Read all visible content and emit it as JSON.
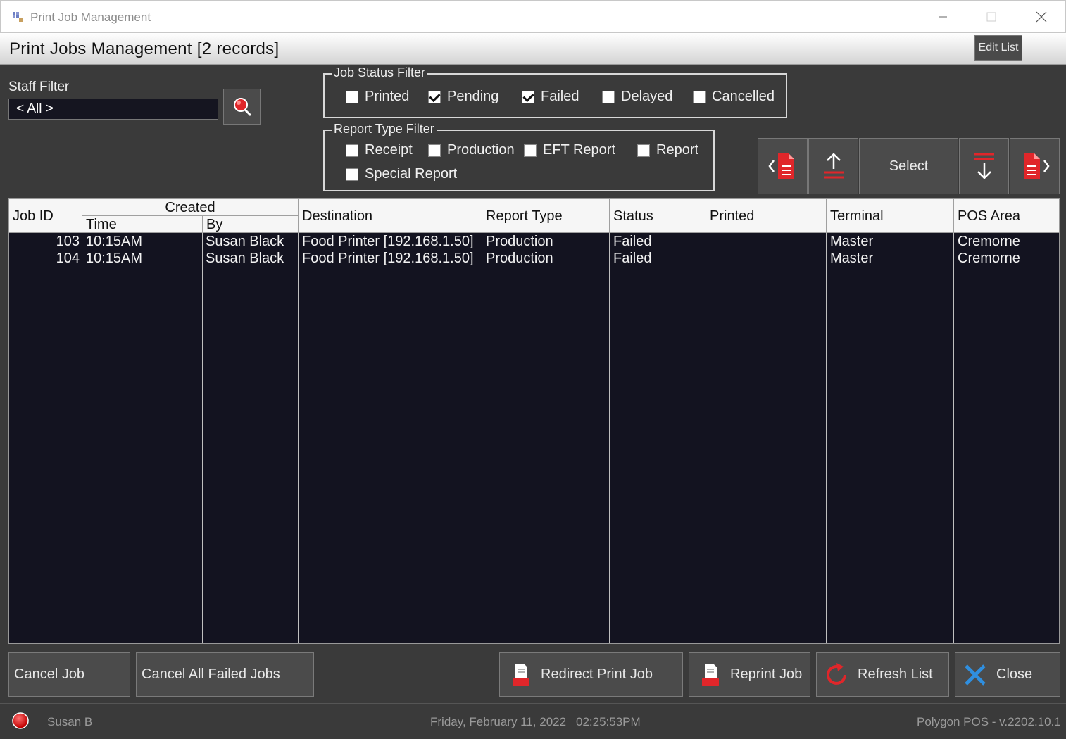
{
  "window": {
    "title": "Print Job Management"
  },
  "header": {
    "title": "Print Jobs Management [2 records]",
    "edit_list_label": "Edit List"
  },
  "staff_filter": {
    "label": "Staff Filter",
    "value": "< All >"
  },
  "job_status_filter": {
    "title": "Job Status Filter",
    "options": [
      {
        "label": "Printed",
        "checked": false
      },
      {
        "label": "Pending",
        "checked": true
      },
      {
        "label": "Failed",
        "checked": true
      },
      {
        "label": "Delayed",
        "checked": false
      },
      {
        "label": "Cancelled",
        "checked": false
      }
    ]
  },
  "report_type_filter": {
    "title": "Report Type Filter",
    "options": [
      {
        "label": "Receipt",
        "checked": false
      },
      {
        "label": "Production",
        "checked": false
      },
      {
        "label": "EFT Report",
        "checked": false
      },
      {
        "label": "Report",
        "checked": false
      },
      {
        "label": "Special Report",
        "checked": false
      }
    ]
  },
  "nav": {
    "select_label": "Select"
  },
  "grid": {
    "columns": {
      "job_id": "Job ID",
      "created": "Created",
      "time": "Time",
      "by": "By",
      "destination": "Destination",
      "report_type": "Report Type",
      "status": "Status",
      "printed": "Printed",
      "terminal": "Terminal",
      "pos_area": "POS Area"
    },
    "rows": [
      {
        "job_id": "103",
        "time": "10:15AM",
        "by": "Susan Black",
        "destination": "Food Printer [192.168.1.50]",
        "report_type": "Production",
        "status": "Failed",
        "printed": "",
        "terminal": "Master",
        "pos_area": "Cremorne"
      },
      {
        "job_id": "104",
        "time": "10:15AM",
        "by": "Susan Black",
        "destination": "Food Printer [192.168.1.50]",
        "report_type": "Production",
        "status": "Failed",
        "printed": "",
        "terminal": "Master",
        "pos_area": "Cremorne"
      }
    ]
  },
  "actions": {
    "cancel_job": "Cancel Job",
    "cancel_all_failed": "Cancel All Failed Jobs",
    "redirect": "Redirect Print Job",
    "reprint": "Reprint Job",
    "refresh": "Refresh List",
    "close": "Close"
  },
  "status": {
    "user": "Susan B",
    "date": "Friday, February 11, 2022",
    "time": "02:25:53PM",
    "version": "Polygon POS - v.2202.10.1",
    "indicator_color": "#e00000"
  },
  "colors": {
    "accent_red": "#e0262a",
    "close_blue": "#2f8fe0"
  }
}
